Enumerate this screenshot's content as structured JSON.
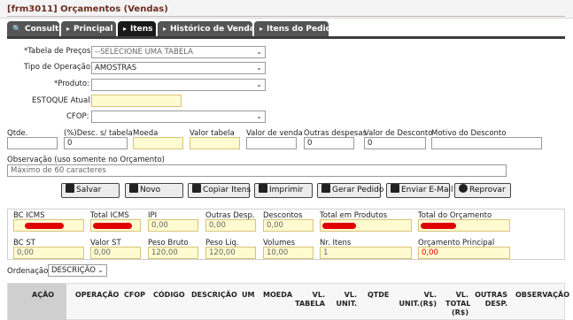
{
  "window": {
    "title": "[frm3011] Orçamentos (Vendas)"
  },
  "tabs": [
    {
      "label": "Consulta",
      "icon": "search-icon"
    },
    {
      "label": "Principal",
      "icon": "arrow-right-icon"
    },
    {
      "label": "Itens",
      "icon": "arrow-right-icon",
      "active": true
    },
    {
      "label": "Histórico de Vendas",
      "icon": "arrow-right-icon"
    },
    {
      "label": "Itens do Pedido",
      "icon": "arrow-right-icon"
    }
  ],
  "form": {
    "tabela_label": "*Tabela de Preços:",
    "tabela_value": "--SELECIONE UMA TABELA",
    "tipo_label": "Tipo de Operação:",
    "tipo_value": "AMOSTRAS",
    "produto_label": "*Produto:",
    "produto_value": "",
    "estoque_label": "ESTOQUE Atual:",
    "estoque_value": "",
    "cfop_label": "CFOP:",
    "cfop_value": ""
  },
  "row2": {
    "qtde_label": "Qtde.",
    "desc_label": "(%)Desc. s/ tabela",
    "desc_value": "0",
    "moeda_label": "Moeda",
    "valor_tabela_label": "Valor tabela",
    "valor_venda_label": "Valor de venda",
    "outras_desp_label": "Outras despesas",
    "outras_desp_value": "0",
    "valor_desc_label": "Valor de Desconto",
    "valor_desc_value": "0",
    "motivo_label": "Motivo do Desconto"
  },
  "obs": {
    "label": "Observação (uso somente no Orçamento)",
    "placeholder": "Máximo de 60 caracteres"
  },
  "buttons": {
    "salvar": "Salvar",
    "novo": "Novo",
    "copiar": "Copiar Itens",
    "imprimir": "Imprimir",
    "gerar": "Gerar Pedido",
    "email": "Enviar E-Mail",
    "reprovar": "Reprovar"
  },
  "totals": {
    "bc_icms_label": "BC ICMS",
    "total_icms_label": "Total ICMS",
    "ipi_label": "IPI",
    "ipi_value": "0,00",
    "outras_label": "Outras Desp.",
    "outras_value": "0,00",
    "descontos_label": "Descontos",
    "descontos_value": "0,00",
    "total_prod_label": "Total em Produtos",
    "total_orc_label": "Total do Orçamento",
    "bc_st_label": "BC ST",
    "bc_st_value": "0,00",
    "valor_st_label": "Valor ST",
    "valor_st_value": "0,00",
    "peso_bruto_label": "Peso Bruto",
    "peso_bruto_value": "120,00",
    "peso_liq_label": "Peso Liq.",
    "peso_liq_value": "120,00",
    "volumes_label": "Volumes",
    "volumes_value": "10,00",
    "nr_itens_label": "Nr. Itens",
    "nr_itens_value": "1",
    "orc_principal_label": "Orçamento Principal",
    "orc_principal_value": "0,00"
  },
  "ordenacao": {
    "label": "Ordenação:",
    "value": "DESCRIÇÃO"
  },
  "grid_headers": {
    "acao": "AÇÃO",
    "operacao": "OPERAÇÃO",
    "cfop": "CFOP",
    "codigo": "CÓDIGO",
    "descricao": "DESCRIÇÃO",
    "um": "UM",
    "moeda": "MOEDA",
    "vl_tabela_1": "VL.",
    "vl_tabela_2": "TABELA",
    "vl_unit_1": "VL.",
    "vl_unit_2": "UNIT.",
    "qtde": "QTDE",
    "vl_unit_rs_1": "VL.",
    "vl_unit_rs_2": "UNIT.(R$)",
    "vl_total_1": "VL.",
    "vl_total_2": "TOTAL",
    "vl_total_3": "(R$)",
    "outras_1": "OUTRAS",
    "outras_2": "DESP.",
    "observacao": "OBSERVAÇÃO"
  }
}
